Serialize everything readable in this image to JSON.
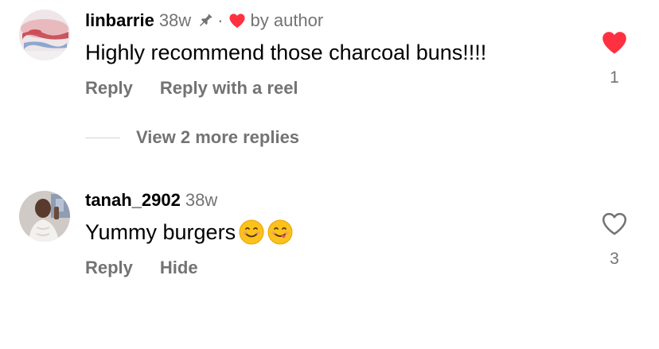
{
  "comments": [
    {
      "username": "linbarrie",
      "time": "38w",
      "pinned": true,
      "liked_by_author": true,
      "by_author_label": "by author",
      "text": "Highly recommend those charcoal buns!!!!",
      "actions": [
        "Reply",
        "Reply with a reel"
      ],
      "like_count": "1",
      "liked": true
    },
    {
      "username": "tanah_2902",
      "time": "38w",
      "text": "Yummy burgers",
      "emojis": [
        "smiling-face-icon",
        "face-savoring-food-icon"
      ],
      "actions": [
        "Reply",
        "Hide"
      ],
      "like_count": "3",
      "liked": false
    }
  ],
  "view_replies_label": "View 2 more replies",
  "colors": {
    "text_primary": "#000000",
    "text_secondary": "#737373",
    "like_red": "#ff3040"
  }
}
